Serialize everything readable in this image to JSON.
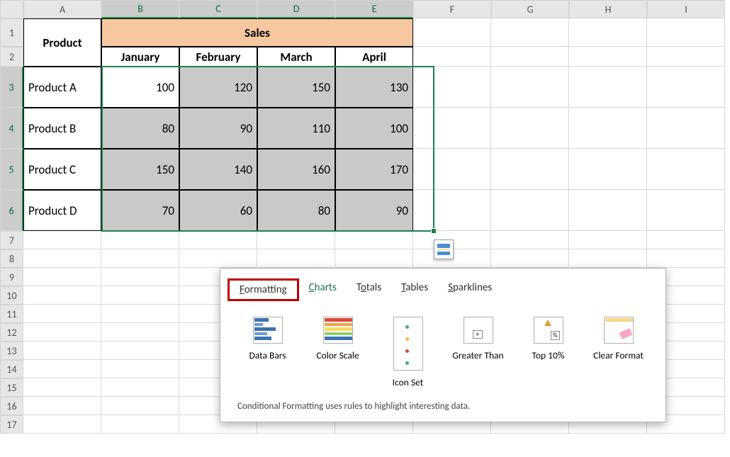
{
  "cols": [
    "A",
    "B",
    "C",
    "D",
    "E",
    "F",
    "G",
    "H",
    "I"
  ],
  "rows": [
    "1",
    "2",
    "3",
    "4",
    "5",
    "6",
    "7",
    "8",
    "9",
    "10",
    "11",
    "12",
    "13",
    "14",
    "15",
    "16",
    "17"
  ],
  "header": {
    "product": "Product",
    "sales": "Sales",
    "months": [
      "January",
      "February",
      "March",
      "April"
    ]
  },
  "products": [
    {
      "name": "Product A",
      "vals": [
        100,
        120,
        150,
        130
      ]
    },
    {
      "name": "Product B",
      "vals": [
        80,
        90,
        110,
        100
      ]
    },
    {
      "name": "Product C",
      "vals": [
        150,
        140,
        160,
        170
      ]
    },
    {
      "name": "Product D",
      "vals": [
        70,
        60,
        80,
        90
      ]
    }
  ],
  "popup": {
    "tabs": [
      "Formatting",
      "Charts",
      "Totals",
      "Tables",
      "Sparklines"
    ],
    "active_tab": 0,
    "items": [
      "Data Bars",
      "Color Scale",
      "Icon Set",
      "Greater Than",
      "Top 10%",
      "Clear Format"
    ],
    "note": "Conditional Formatting uses rules to highlight interesting data."
  }
}
